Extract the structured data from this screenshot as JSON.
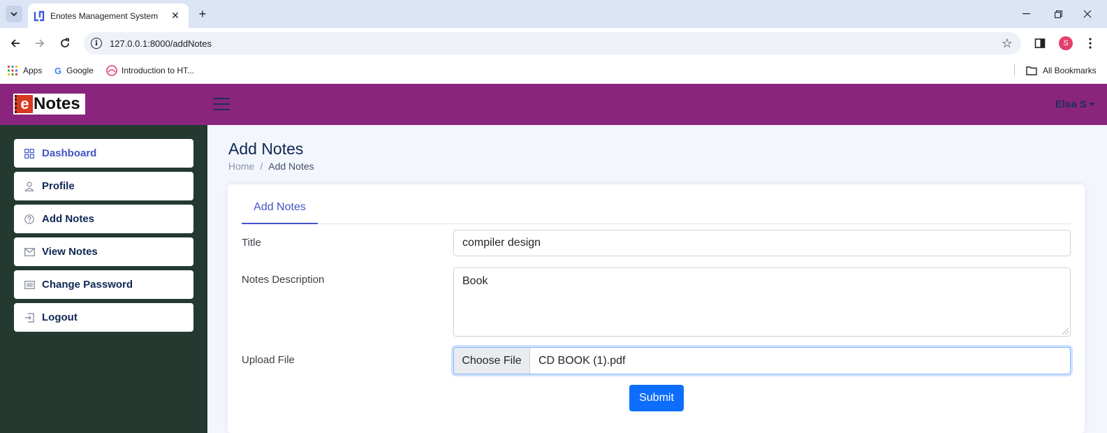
{
  "browser": {
    "tab_title": "Enotes Management System",
    "url": "127.0.0.1:8000/addNotes",
    "avatar_letter": "S",
    "bookmarks": [
      {
        "label": "Apps",
        "icon": "apps-grid-icon"
      },
      {
        "label": "Google",
        "icon": "google-icon"
      },
      {
        "label": "Introduction to HT...",
        "icon": "site-icon"
      }
    ],
    "all_bookmarks": "All Bookmarks"
  },
  "header": {
    "logo_e": "e",
    "logo_rest": "Notes",
    "user_name": "Elsa S"
  },
  "sidebar": {
    "items": [
      {
        "label": "Dashboard",
        "icon": "grid-icon",
        "active": true
      },
      {
        "label": "Profile",
        "icon": "person-icon"
      },
      {
        "label": "Add Notes",
        "icon": "question-circle-icon"
      },
      {
        "label": "View Notes",
        "icon": "envelope-icon"
      },
      {
        "label": "Change Password",
        "icon": "list-icon"
      },
      {
        "label": "Logout",
        "icon": "box-arrow-in-right-icon"
      }
    ]
  },
  "page": {
    "title": "Add Notes",
    "breadcrumb": {
      "home": "Home",
      "separator": "/",
      "current": "Add Notes"
    }
  },
  "form": {
    "tab_label": "Add Notes",
    "title_label": "Title",
    "title_value": "compiler design",
    "description_label": "Notes Description",
    "description_value": "Book",
    "upload_label": "Upload File",
    "choose_file_label": "Choose File",
    "file_name": "CD BOOK (1).pdf",
    "submit_label": "Submit"
  },
  "colors": {
    "header_bg": "#8a257d",
    "sidebar_bg": "#243930",
    "accent": "#4154c5",
    "submit_bg": "#0d6efd"
  }
}
